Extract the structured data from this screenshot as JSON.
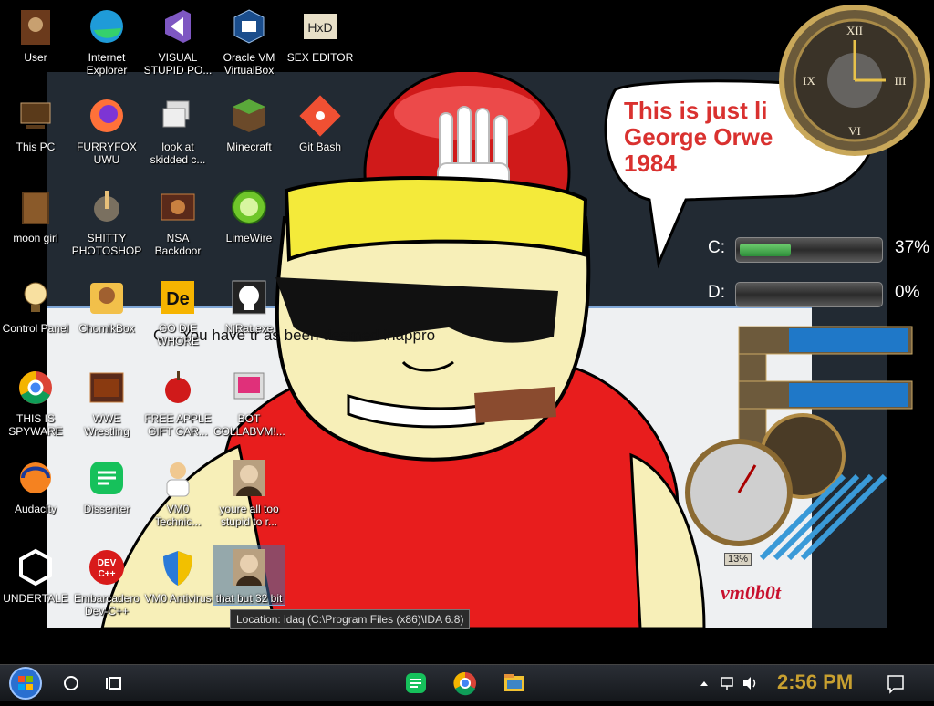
{
  "desktop_icons": [
    {
      "label": "User",
      "icon": "user-folder-icon"
    },
    {
      "label": "Internet Explorer",
      "icon": "edge-icon"
    },
    {
      "label": "VISUAL STUPID PO...",
      "icon": "visual-studio-icon"
    },
    {
      "label": "Oracle VM VirtualBox",
      "icon": "virtualbox-icon"
    },
    {
      "label": "SEX EDITOR",
      "icon": "hxd-icon"
    },
    {
      "label": "This PC",
      "icon": "this-pc-icon"
    },
    {
      "label": "FURRYFOX UWU",
      "icon": "firefox-icon"
    },
    {
      "label": "look at skidded c...",
      "icon": "stacked-windows-icon"
    },
    {
      "label": "Minecraft",
      "icon": "minecraft-icon"
    },
    {
      "label": "Git Bash",
      "icon": "git-icon"
    },
    {
      "label": "moon girl",
      "icon": "wooden-box-icon"
    },
    {
      "label": "SHITTY PHOTOSHOP",
      "icon": "gimp-icon"
    },
    {
      "label": "NSA Backdoor",
      "icon": "nsa-icon"
    },
    {
      "label": "LimeWire",
      "icon": "limewire-icon"
    },
    {
      "label": "Control Panel",
      "icon": "lightbulb-icon"
    },
    {
      "label": "ChomikBox",
      "icon": "chomikbox-icon"
    },
    {
      "label": "GO DIE WHORE",
      "icon": "de-icon"
    },
    {
      "label": "NjRat.exe",
      "icon": "skull-icon"
    },
    {
      "label": "THIS IS SPYWARE",
      "icon": "chrome-icon"
    },
    {
      "label": "WWE Wrestling",
      "icon": "wwe-icon"
    },
    {
      "label": "FREE APPLE GIFT CAR...",
      "icon": "apple-icon"
    },
    {
      "label": "BOT COLLABVM!...",
      "icon": "bot-icon"
    },
    {
      "label": "Audacity",
      "icon": "audacity-icon"
    },
    {
      "label": "Dissenter",
      "icon": "dissenter-icon"
    },
    {
      "label": "VM0 Technic...",
      "icon": "technician-icon"
    },
    {
      "label": "youre all too stupid to r...",
      "icon": "portrait-icon"
    },
    {
      "label": "UNDERTALE",
      "icon": "unity-icon"
    },
    {
      "label": "Embarcadero Dev-C++",
      "icon": "devcpp-icon"
    },
    {
      "label": "VM0 Antivirus",
      "icon": "shield-icon"
    },
    {
      "label": "that but 32 bit",
      "icon": "portrait-icon"
    }
  ],
  "tooltip": "Location: idaq (C:\\Program Files (x86)\\IDA 6.8)",
  "wallpaper": {
    "speech": "This is just li\nGeorge Orwe\n1984",
    "hidden_message": "C...  You have tr                               as been deemed inappro"
  },
  "widgets": {
    "drives": [
      {
        "label": "C:",
        "percent_text": "37%",
        "fill": 0.37
      },
      {
        "label": "D:",
        "percent_text": "0%",
        "fill": 0.0
      }
    ],
    "cpu_gauge_text": "13%",
    "signature": "vm0b0t"
  },
  "taskbar": {
    "start_icon": "windows-start-icon",
    "time": "2:56 PM",
    "pinned": [
      "dissenter-icon",
      "chrome-icon",
      "file-explorer-icon"
    ]
  },
  "colors": {
    "speech_red": "#d9312f",
    "clock_gold": "#c8a030",
    "signature_red": "#c8102e"
  }
}
